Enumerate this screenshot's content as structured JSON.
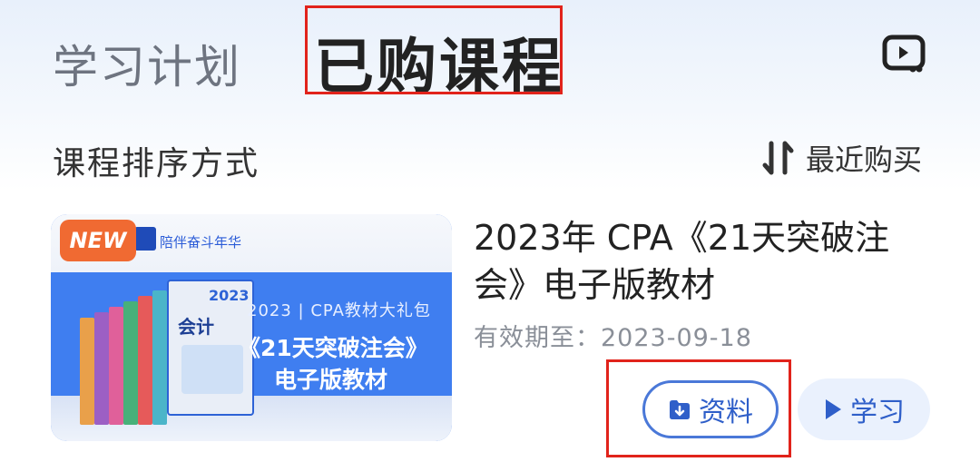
{
  "tabs": {
    "plan_label": "学习计划",
    "purchased_label": "已购课程"
  },
  "header": {
    "screen_icon": "screen-play-icon"
  },
  "sort": {
    "label": "课程排序方式",
    "value": "最近购买",
    "icon": "sort-arrows-icon"
  },
  "course": {
    "title": "2023年 CPA《21天突破注会》电子版教材",
    "expiry": "有效期至：2023-09-18",
    "thumbnail": {
      "badge": "NEW",
      "slogan": "陪伴奋斗年华",
      "book_title": "会计",
      "book_year": "2023",
      "line1": "2023 | CPA教材大礼包",
      "line2": "《21天突破注会》",
      "line3": "电子版教材"
    },
    "materials_button": "资料",
    "study_button": "学习"
  },
  "colors": {
    "accent": "#2f5fc9",
    "highlight": "#e1231b",
    "badge": "#f06a32"
  }
}
